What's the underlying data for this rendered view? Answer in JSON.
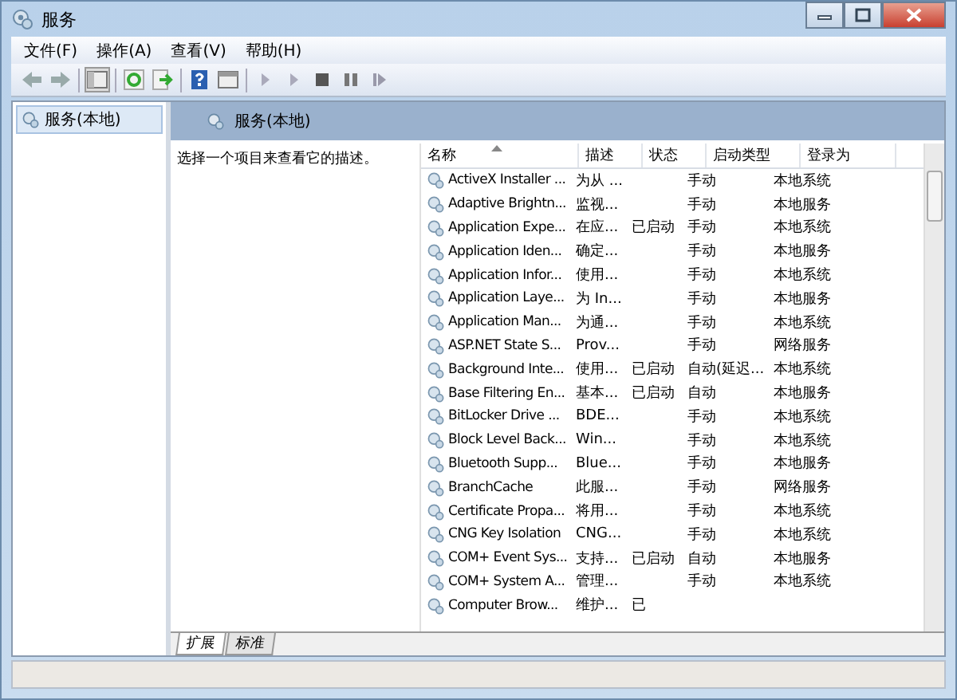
{
  "window": {
    "title": "服务"
  },
  "menu": [
    "文件(F)",
    "操作(A)",
    "查看(V)",
    "帮助(H)"
  ],
  "tree": [
    {
      "label": "服务(本地)",
      "selected": true
    }
  ],
  "panel": {
    "title": "服务(本地)",
    "description": "选择一个项目来查看它的描述。"
  },
  "table": {
    "columns": [
      "名称",
      "描述",
      "状态",
      "启动类型",
      "登录为"
    ],
    "rows": [
      [
        "ActiveX Installer ...",
        "为从 ...",
        "",
        "手动",
        "本地系统"
      ],
      [
        "Adaptive Brightn...",
        "监视...",
        "",
        "手动",
        "本地服务"
      ],
      [
        "Application Expe...",
        "在应...",
        "已启动",
        "手动",
        "本地系统"
      ],
      [
        "Application Iden...",
        "确定...",
        "",
        "手动",
        "本地服务"
      ],
      [
        "Application Infor...",
        "使用...",
        "",
        "手动",
        "本地系统"
      ],
      [
        "Application Laye...",
        "为 In...",
        "",
        "手动",
        "本地服务"
      ],
      [
        "Application Man...",
        "为通...",
        "",
        "手动",
        "本地系统"
      ],
      [
        "ASP.NET State S...",
        "Prov...",
        "",
        "手动",
        "网络服务"
      ],
      [
        "Background Inte...",
        "使用...",
        "已启动",
        "自动(延迟...",
        "本地系统"
      ],
      [
        "Base Filtering En...",
        "基本...",
        "已启动",
        "自动",
        "本地服务"
      ],
      [
        "BitLocker Drive ...",
        "BDE...",
        "",
        "手动",
        "本地系统"
      ],
      [
        "Block Level Back...",
        "Win...",
        "",
        "手动",
        "本地系统"
      ],
      [
        "Bluetooth Supp...",
        "Blue...",
        "",
        "手动",
        "本地服务"
      ],
      [
        "BranchCache",
        "此服...",
        "",
        "手动",
        "网络服务"
      ],
      [
        "Certificate Propa...",
        "将用...",
        "",
        "手动",
        "本地系统"
      ],
      [
        "CNG Key Isolation",
        "CNG...",
        "",
        "手动",
        "本地系统"
      ],
      [
        "COM+ Event Sys...",
        "支持...",
        "已启动",
        "自动",
        "本地服务"
      ],
      [
        "COM+ System A...",
        "管理...",
        "",
        "手动",
        "本地系统"
      ],
      [
        "Computer Brow...",
        "维护...",
        "已",
        "",
        ""
      ]
    ]
  },
  "tabs": [
    {
      "label": "扩展",
      "selected": true
    },
    {
      "label": "标准",
      "selected": false
    }
  ]
}
